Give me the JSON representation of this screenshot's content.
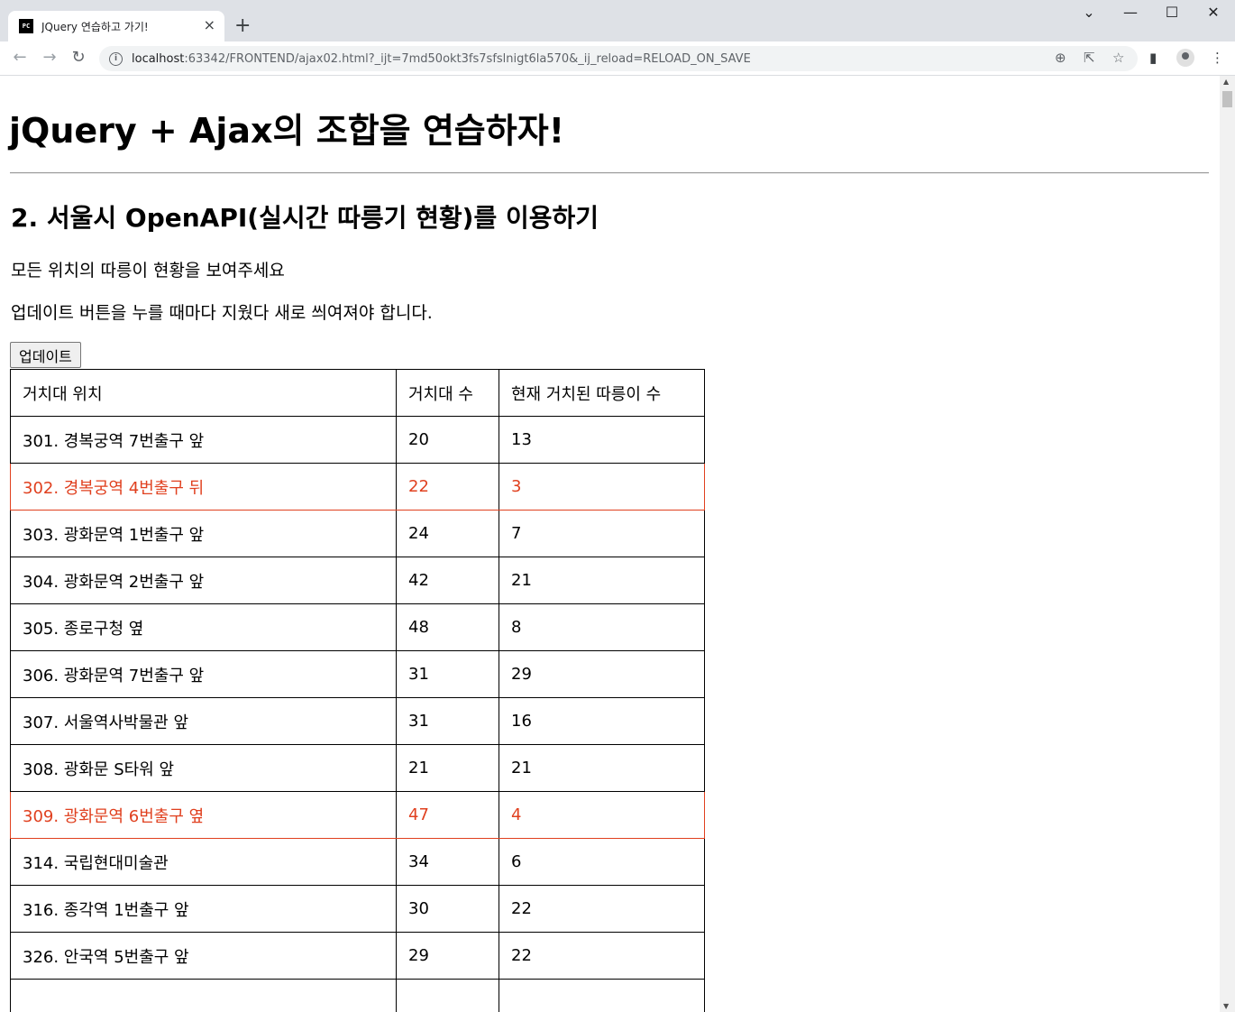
{
  "browser": {
    "tab_favicon": "PC",
    "tab_title": "JQuery 연습하고 가기!",
    "tab_close": "×",
    "new_tab": "+",
    "url_host": "localhost",
    "url_rest": ":63342/FRONTEND/ajax02.html?_ijt=7md50okt3fs7sfslnigt6la570&_ij_reload=RELOAD_ON_SAVE",
    "controls": {
      "minimize": "—",
      "maximize": "☐",
      "close": "✕",
      "tabsearch": "⌄"
    },
    "icons": {
      "back": "back-arrow-icon",
      "forward": "forward-arrow-icon",
      "reload": "reload-icon",
      "info": "info-icon",
      "zoom": "zoom-icon",
      "share": "share-icon",
      "bookmark": "star-icon",
      "sidepanel": "side-panel-icon",
      "profile": "profile-avatar",
      "menu": "kebab-menu-icon"
    }
  },
  "page": {
    "heading": "jQuery + Ajax의 조합을 연습하자!",
    "subheading": "2. 서울시 OpenAPI(실시간 따릉기 현황)를 이용하기",
    "desc1": "모든 위치의 따릉이 현황을 보여주세요",
    "desc2": "업데이트 버튼을 누를 때마다 지웠다 새로 씌여져야 합니다.",
    "update_button": "업데이트",
    "highlight_color": "#e0401f",
    "table": {
      "headers": [
        "거치대 위치",
        "거치대 수",
        "현재 거치된 따릉이 수"
      ],
      "rows": [
        {
          "location": "301. 경복궁역 7번출구 앞",
          "racks": "20",
          "bikes": "13",
          "low": false
        },
        {
          "location": "302. 경복궁역 4번출구 뒤",
          "racks": "22",
          "bikes": "3",
          "low": true
        },
        {
          "location": "303. 광화문역 1번출구 앞",
          "racks": "24",
          "bikes": "7",
          "low": false
        },
        {
          "location": "304. 광화문역 2번출구 앞",
          "racks": "42",
          "bikes": "21",
          "low": false
        },
        {
          "location": "305. 종로구청 옆",
          "racks": "48",
          "bikes": "8",
          "low": false
        },
        {
          "location": "306. 광화문역 7번출구 앞",
          "racks": "31",
          "bikes": "29",
          "low": false
        },
        {
          "location": "307. 서울역사박물관 앞",
          "racks": "31",
          "bikes": "16",
          "low": false
        },
        {
          "location": "308. 광화문 S타워 앞",
          "racks": "21",
          "bikes": "21",
          "low": false
        },
        {
          "location": "309. 광화문역 6번출구 옆",
          "racks": "47",
          "bikes": "4",
          "low": true
        },
        {
          "location": "314. 국립현대미술관",
          "racks": "34",
          "bikes": "6",
          "low": false
        },
        {
          "location": "316. 종각역 1번출구 앞",
          "racks": "30",
          "bikes": "22",
          "low": false
        },
        {
          "location": "326. 안국역 5번출구 앞",
          "racks": "29",
          "bikes": "22",
          "low": false
        },
        {
          "location": "",
          "racks": "",
          "bikes": "",
          "low": false
        }
      ]
    }
  }
}
